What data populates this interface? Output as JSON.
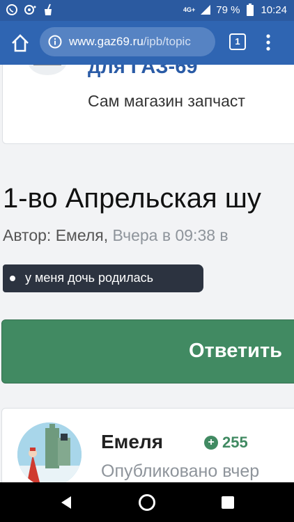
{
  "status_bar": {
    "network": "4G+",
    "battery": "79 %",
    "time": "10:24"
  },
  "browser": {
    "url_domain": "www.gaz69.ru",
    "url_path": "/ipb/topic",
    "tab_count": "1"
  },
  "store_card": {
    "title": "для ГАЗ-69",
    "subtitle": "Сам магазин запчаст"
  },
  "topic": {
    "title": "1-во Апрельская шу",
    "author_prefix": "Автор: Емеля,",
    "date": "Вчера в 09:38 в",
    "tag": "у меня дочь родилась"
  },
  "reply_button": {
    "label": "Ответить"
  },
  "post": {
    "author": "Емеля",
    "reputation": "255",
    "published": "Опубликовано вчер"
  },
  "colors": {
    "status_bar": "#2b5aa0",
    "toolbar": "#2f65b2",
    "accent_green": "#418a62",
    "link_blue": "#2a5ba6"
  },
  "icons": {
    "home": "home-icon",
    "info": "info-icon",
    "menu": "overflow-menu-icon",
    "reputation": "plus-circle-icon"
  }
}
